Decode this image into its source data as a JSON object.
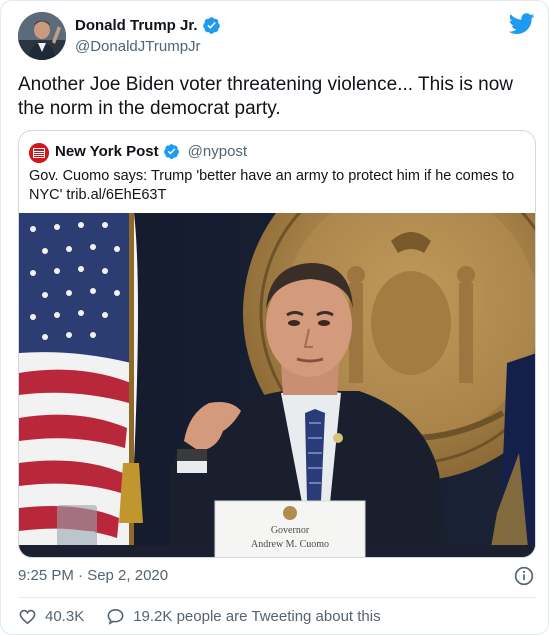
{
  "author": {
    "name": "Donald Trump Jr.",
    "handle": "@DonaldJTrumpJr",
    "verified": true,
    "icons": {
      "avatar": "profile-photo",
      "verified": "verified-badge-icon",
      "platform": "twitter-bird-icon"
    }
  },
  "tweet": {
    "text": "Another Joe Biden voter threatening violence... This is now the norm in the democrat party."
  },
  "quoted_tweet": {
    "name": "New York Post",
    "handle": "@nypost",
    "logo_text": "NEW YORK POST",
    "verified": true,
    "text": "Gov. Cuomo says: Trump 'better have an army to protect him if he comes to NYC' trib.al/6EhE63T",
    "photo": {
      "placard_line1": "Governor",
      "placard_line2": "Andrew M. Cuomo"
    }
  },
  "footer": {
    "timestamp": "9:25 PM · Sep 2, 2020",
    "likes": "40.3K",
    "replies_label": "19.2K people are Tweeting about this"
  },
  "colors": {
    "brand": "#1d9bf0",
    "nypost_red": "#d1161d",
    "muted_text": "#536471"
  }
}
